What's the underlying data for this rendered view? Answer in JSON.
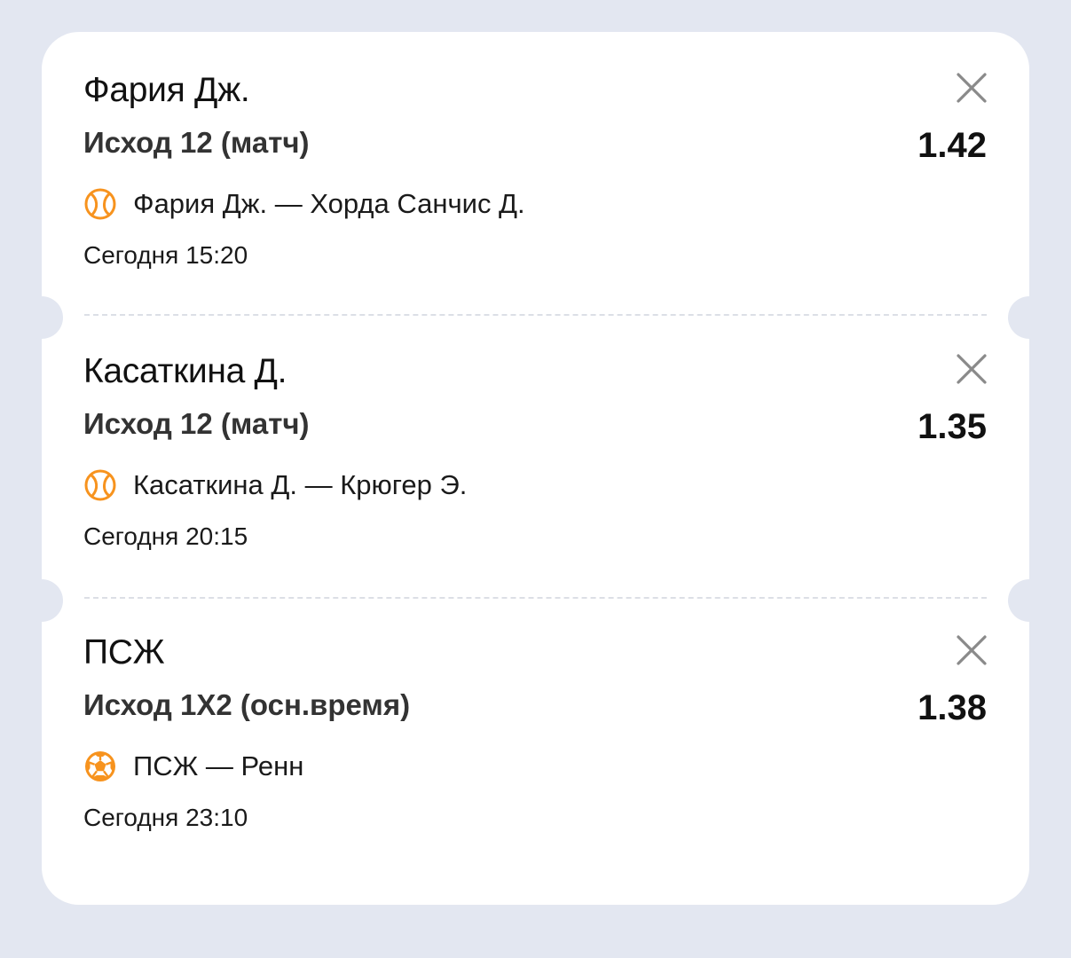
{
  "bets": [
    {
      "selection": "Фария Дж.",
      "market": "Исход 12 (матч)",
      "odds": "1.42",
      "event": "Фария Дж. — Хорда Санчис Д.",
      "time": "Сегодня 15:20",
      "sport_icon": "tennis-ball-icon"
    },
    {
      "selection": "Касаткина Д.",
      "market": "Исход 12 (матч)",
      "odds": "1.35",
      "event": "Касаткина Д. — Крюгер Э.",
      "time": "Сегодня 20:15",
      "sport_icon": "tennis-ball-icon"
    },
    {
      "selection": "ПСЖ",
      "market": "Исход 1Х2 (осн.время)",
      "odds": "1.38",
      "event": "ПСЖ — Ренн",
      "time": "Сегодня 23:10",
      "sport_icon": "soccer-ball-icon"
    }
  ],
  "colors": {
    "background": "#e3e7f1",
    "card": "#ffffff",
    "accent": "#f7931e",
    "close_icon": "#8a8a8a"
  },
  "icons": {
    "close": "close-icon"
  }
}
